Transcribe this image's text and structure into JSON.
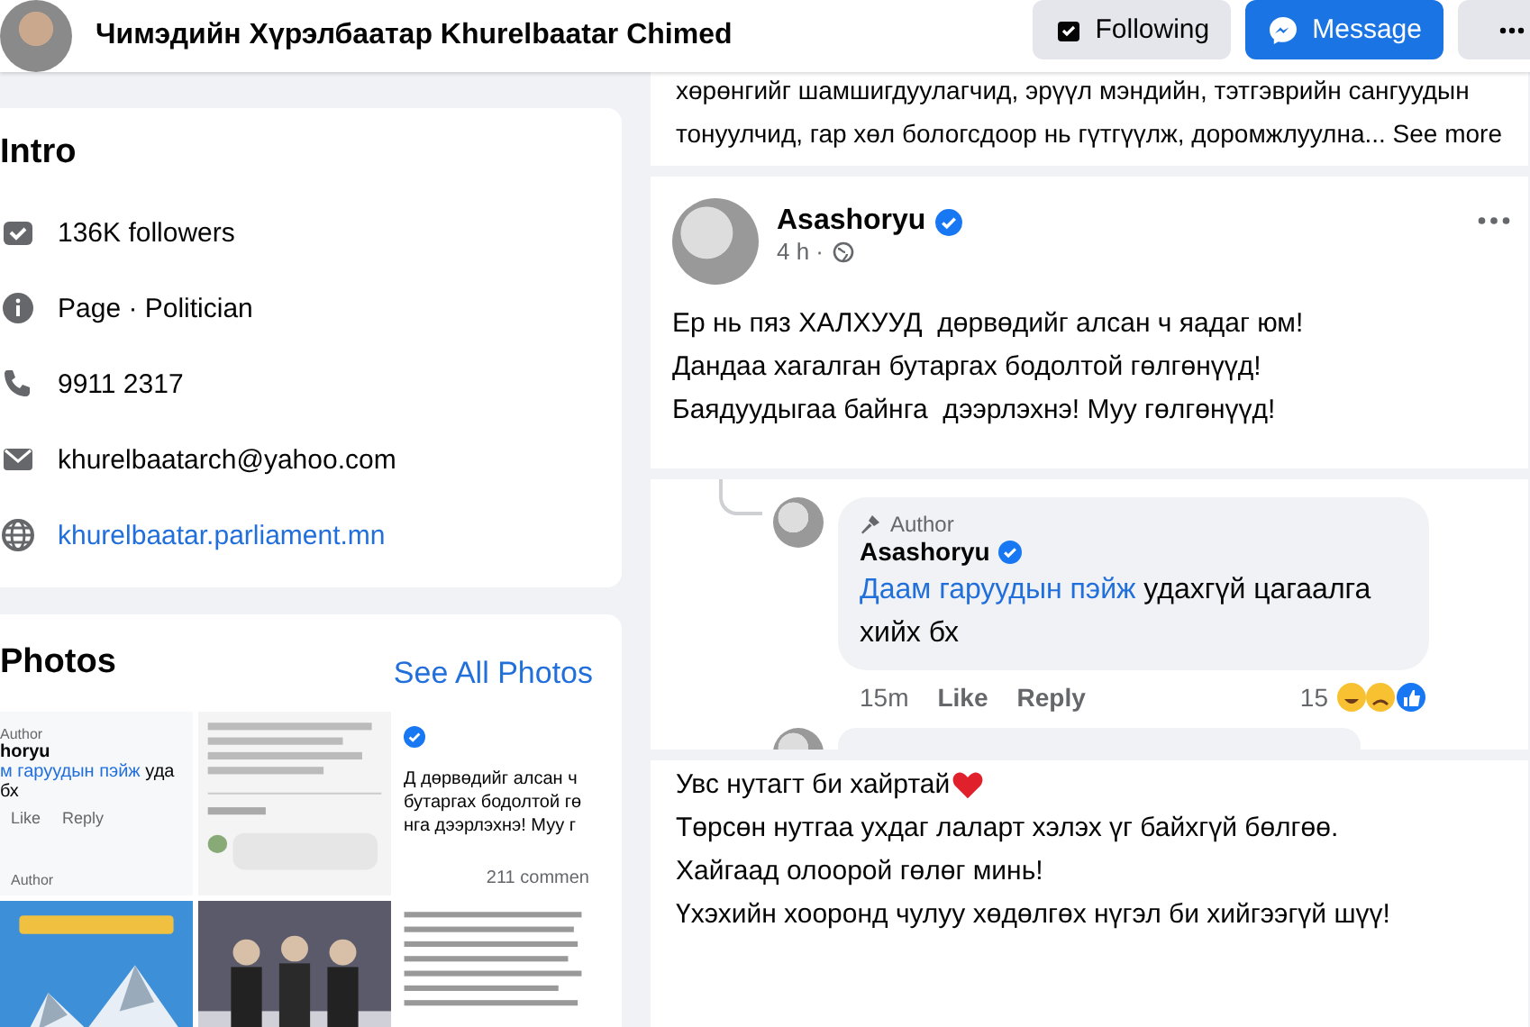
{
  "header": {
    "name": "Чимэдийн Хүрэлбаатар Khurelbaatar Chimed",
    "buttons": [
      {
        "kind": "following",
        "label": "Following"
      },
      {
        "kind": "message",
        "label": "Message"
      },
      {
        "kind": "more"
      }
    ]
  },
  "intro": {
    "title": "Intro",
    "items": [
      {
        "kind": "followers",
        "text": "136K followers",
        "link": false
      },
      {
        "kind": "info",
        "text": "Page · Politician",
        "link": false
      },
      {
        "kind": "phone",
        "text": "9911 2317",
        "link": false
      },
      {
        "kind": "email",
        "text": "khurelbaatarch@yahoo.com",
        "link": false
      },
      {
        "kind": "web",
        "text": "khurelbaatar.parliament.mn",
        "link": true
      }
    ]
  },
  "photos": {
    "title": "Photos",
    "link": "See All Photos",
    "thumbnails": [
      {
        "kind": "comment",
        "badge": "Author",
        "name": "horyu",
        "link": "м гаруудын пэйж",
        "text": "уда",
        "line2": "бх",
        "actions": [
          "Like",
          "Reply"
        ],
        "footer": "Author"
      },
      {
        "kind": "picture"
      },
      {
        "kind": "post",
        "lines": [
          "Д  дөрвөдийг алсан ч",
          "бутаргах бодолтой гө",
          "нга  дээрлэхнэ! Муу г"
        ],
        "footer": "211 commen"
      },
      {
        "kind": "picture"
      },
      {
        "kind": "picture"
      },
      {
        "kind": "picture"
      }
    ]
  },
  "feed": {
    "excerpt": {
      "text": "хөрөнгийг шамшигдуулагчид, эрүүл мэндийн, тэтгэврийн сангуудын тонуулчид, гар хөл бологсдоор нь гүтгүүлж, доромжлуулна...",
      "see_more": "See more"
    },
    "post": {
      "author": "Asashoryu",
      "verified": true,
      "time": "4 h ·",
      "lines": [
        "Ер нь пяз ХАЛХУУД  дөрвөдийг алсан ч яадаг юм!",
        "Дандаа хагалган бутаргах бодолтой гөлгөнүүд!",
        "Баядуудыгаа байнга  дээрлэхнэ! Муу гөлгөнүүд!"
      ]
    },
    "reply": {
      "badge": "Author",
      "author": "Asashoryu",
      "verified": true,
      "link": "Даам гаруудын пэйж",
      "text": "удахгүй цагаалга хийх бх",
      "time": "15m",
      "actions": [
        "Like",
        "Reply"
      ],
      "count": "15"
    },
    "text_post": {
      "lines": [
        "Увс нутагт би хайртай",
        "Төрсөн нутгаа ухдаг лаларт хэлэх үг байхгүй бөлгөө.",
        "Хайгаад олоорой гөлөг минь!",
        "Үхэхийн хооронд чулуу хөдөлгөх нүгэл би хийгээгүй шүү!"
      ]
    }
  }
}
